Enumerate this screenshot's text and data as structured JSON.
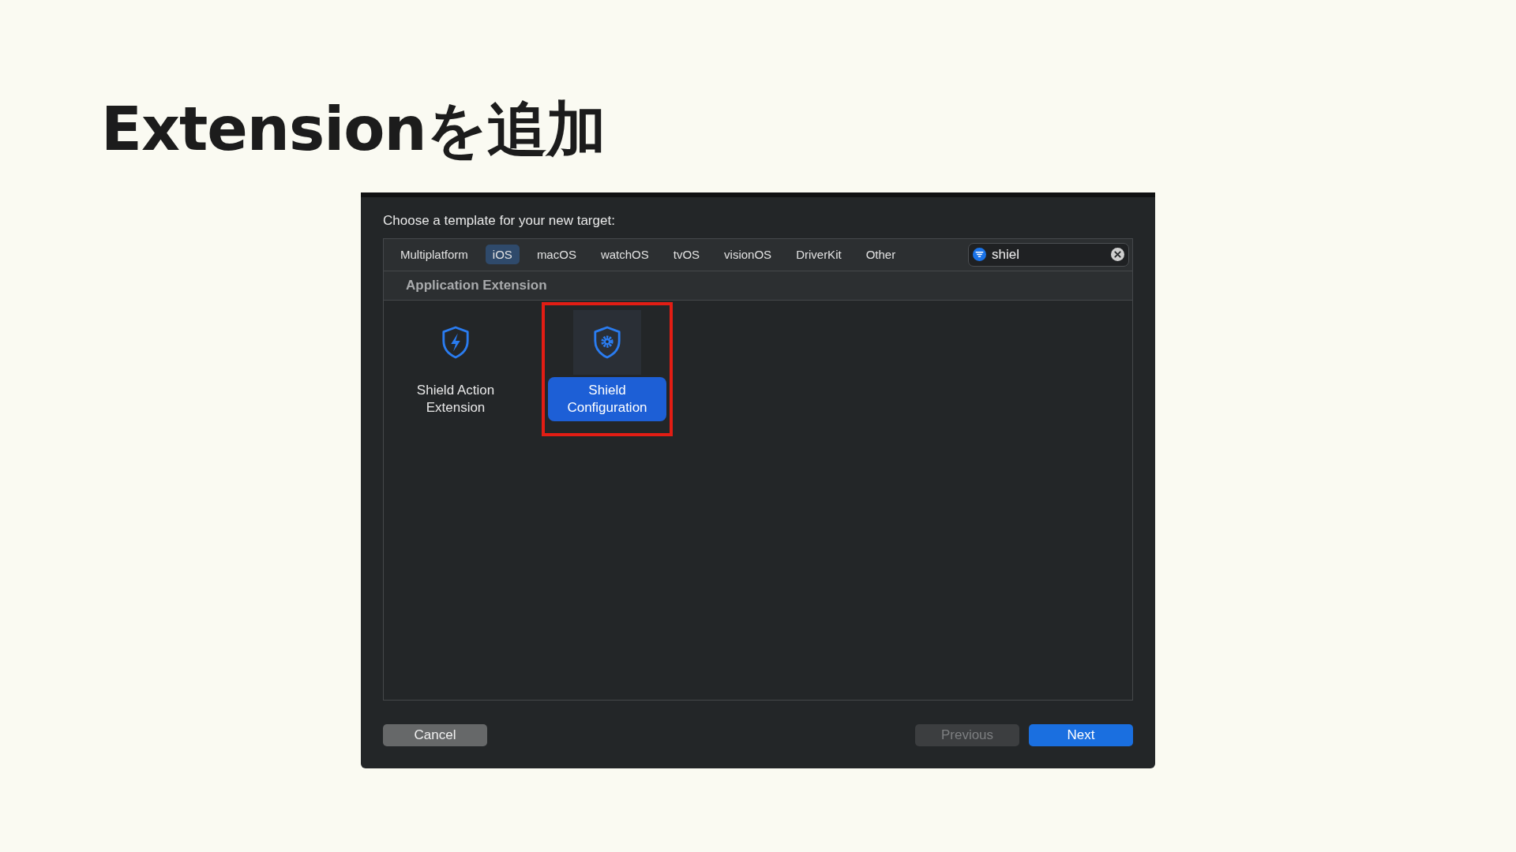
{
  "slide": {
    "title": "Extensionを追加"
  },
  "dialog": {
    "prompt": "Choose a template for your new target:",
    "tabs": [
      {
        "label": "Multiplatform",
        "selected": false
      },
      {
        "label": "iOS",
        "selected": true
      },
      {
        "label": "macOS",
        "selected": false
      },
      {
        "label": "watchOS",
        "selected": false
      },
      {
        "label": "tvOS",
        "selected": false
      },
      {
        "label": "visionOS",
        "selected": false
      },
      {
        "label": "DriverKit",
        "selected": false
      },
      {
        "label": "Other",
        "selected": false
      }
    ],
    "search": {
      "value": "shiel"
    },
    "section": "Application Extension",
    "templates": [
      {
        "name": "Shield Action Extension",
        "selected": false,
        "highlighted": false
      },
      {
        "name": "Shield Configuration",
        "selected": true,
        "highlighted": true
      }
    ],
    "buttons": [
      {
        "label": "Cancel",
        "kind": "cancel",
        "disabled": false
      },
      {
        "label": "Previous",
        "kind": "secondary",
        "disabled": true
      },
      {
        "label": "Next",
        "kind": "primary",
        "disabled": false
      }
    ]
  }
}
